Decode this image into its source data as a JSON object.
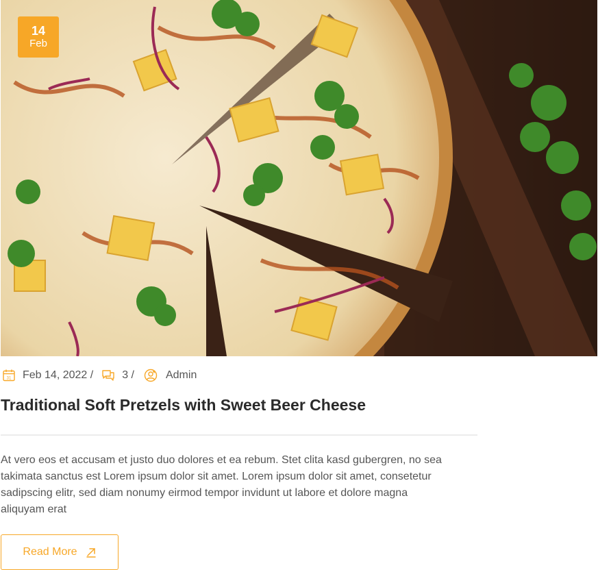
{
  "post": {
    "badge": {
      "day": "14",
      "month": "Feb"
    },
    "meta": {
      "date": "Feb 14, 2022 /",
      "comments": "3 /",
      "author": "Admin",
      "date_icon": "calendar-icon",
      "comments_icon": "comments-icon",
      "author_icon": "user-icon"
    },
    "title": "Traditional Soft Pretzels with Sweet Beer Cheese",
    "excerpt": "At vero eos et accusam et justo duo dolores et ea rebum. Stet clita kasd gubergren, no sea takimata sanctus est Lorem ipsum dolor sit amet. Lorem ipsum dolor sit amet, consetetur sadipscing elitr, sed diam nonumy eirmod tempor invidunt ut labore et dolore magna aliquyam erat",
    "read_more_label": "Read More",
    "read_more_icon": "arrow-up-right-icon"
  },
  "colors": {
    "accent": "#f7a727",
    "title": "#2a2a2a",
    "text": "#555555",
    "divider": "#ececec"
  }
}
